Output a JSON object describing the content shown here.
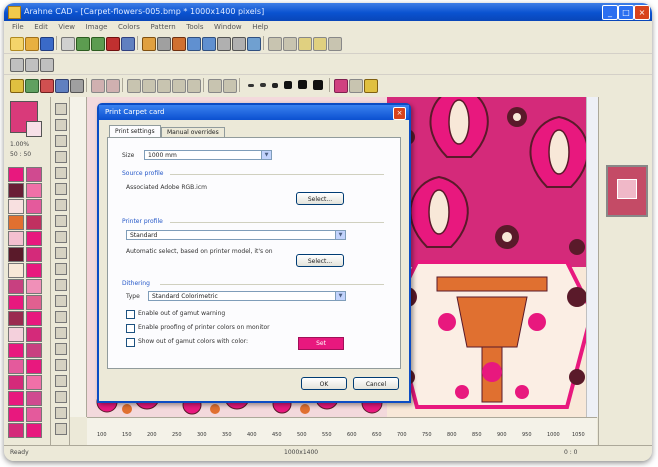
{
  "window": {
    "title": "Arahne CAD - [Carpet-flowers-005.bmp * 1000x1400 pixels]",
    "minimize_glyph": "_",
    "maximize_glyph": "□",
    "close_glyph": "×"
  },
  "menu": [
    "File",
    "Edit",
    "View",
    "Image",
    "Colors",
    "Pattern",
    "Tools",
    "Window",
    "Help"
  ],
  "dialog": {
    "title": "Print Carpet card",
    "tabs": [
      "Print settings",
      "Manual overrides"
    ],
    "close_glyph": "×",
    "fields": {
      "size_label": "Size",
      "size_value": "1000 mm",
      "source_section_label": "Source profile",
      "source_text": "Associated Adobe RGB.icm",
      "source_button": "Select...",
      "printer_section_label": "Printer profile",
      "printer_value": "Standard",
      "printer_text": "Automatic select, based on printer model, it's on",
      "printer_button": "Select...",
      "dithering_section_label": "Dithering",
      "dithering_label": "Type",
      "dithering_value": "Standard Colorimetric",
      "checkbox_1": "Enable out of gamut warning",
      "checkbox_2": "Enable proofing of printer colors on monitor",
      "checkbox_3": "Show out of gamut colors with color:",
      "gamut_color_button": "Set"
    },
    "ok_button": "OK",
    "cancel_button": "Cancel"
  },
  "left_panel": {
    "label_1": "1.00%",
    "label_2": "50 : 50"
  },
  "status": {
    "left_text": "Ready",
    "middle_text": "1000x1400",
    "coord_text": "0 : 0"
  },
  "ruler_ticks": [
    "100",
    "150",
    "200",
    "250",
    "300",
    "350",
    "400",
    "450",
    "500",
    "550",
    "600",
    "650",
    "700",
    "750",
    "800",
    "850",
    "900",
    "950",
    "1000",
    "1050"
  ],
  "colors": {
    "accent_pink": "#e8187e",
    "carpet_magenta": "#d42a7a",
    "carpet_dark": "#5a1a2a",
    "carpet_orange": "#e07030",
    "carpet_cream": "#f8e8d8",
    "titlebar_blue": "#0a52d0"
  },
  "icons": [
    "app-icon",
    "new-file-icon",
    "open-folder-icon",
    "save-icon",
    "print-icon",
    "undo-icon",
    "redo-icon",
    "zoom-in-icon",
    "zoom-out-icon",
    "pencil-icon",
    "brush-icon",
    "fill-icon",
    "eraser-icon",
    "select-icon",
    "eyedropper-icon",
    "text-icon",
    "line-icon",
    "rectangle-icon",
    "ellipse-icon"
  ]
}
